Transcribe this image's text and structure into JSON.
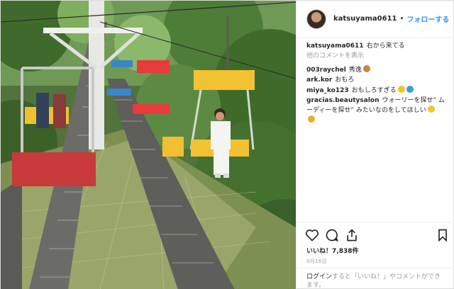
{
  "post": {
    "username": "katsuyama0611",
    "separator": "•",
    "follow_label": "フォローする"
  },
  "caption": {
    "username": "katsuyama0611",
    "text": "右から来てる"
  },
  "view_more_label": "他のコメントを表示",
  "comments": [
    {
      "user": "003raychel",
      "text": "秀逸"
    },
    {
      "user": "ark.kor",
      "text": "おもろ"
    },
    {
      "user": "miya_ko123",
      "text": "おもしろすぎる"
    },
    {
      "user": "gracias.beautysalon",
      "text": "ウォーリーを探せ” ムーディーを探せ” みたいなのをしてほしい"
    }
  ],
  "likes": {
    "label": "いいね！",
    "count": "7,838件"
  },
  "date": "9月16日",
  "login": {
    "link": "ログイン",
    "text": "すると「いいね！」やコメントができます。"
  },
  "icons": [
    "heart-icon",
    "comment-icon",
    "share-icon",
    "bookmark-icon"
  ]
}
